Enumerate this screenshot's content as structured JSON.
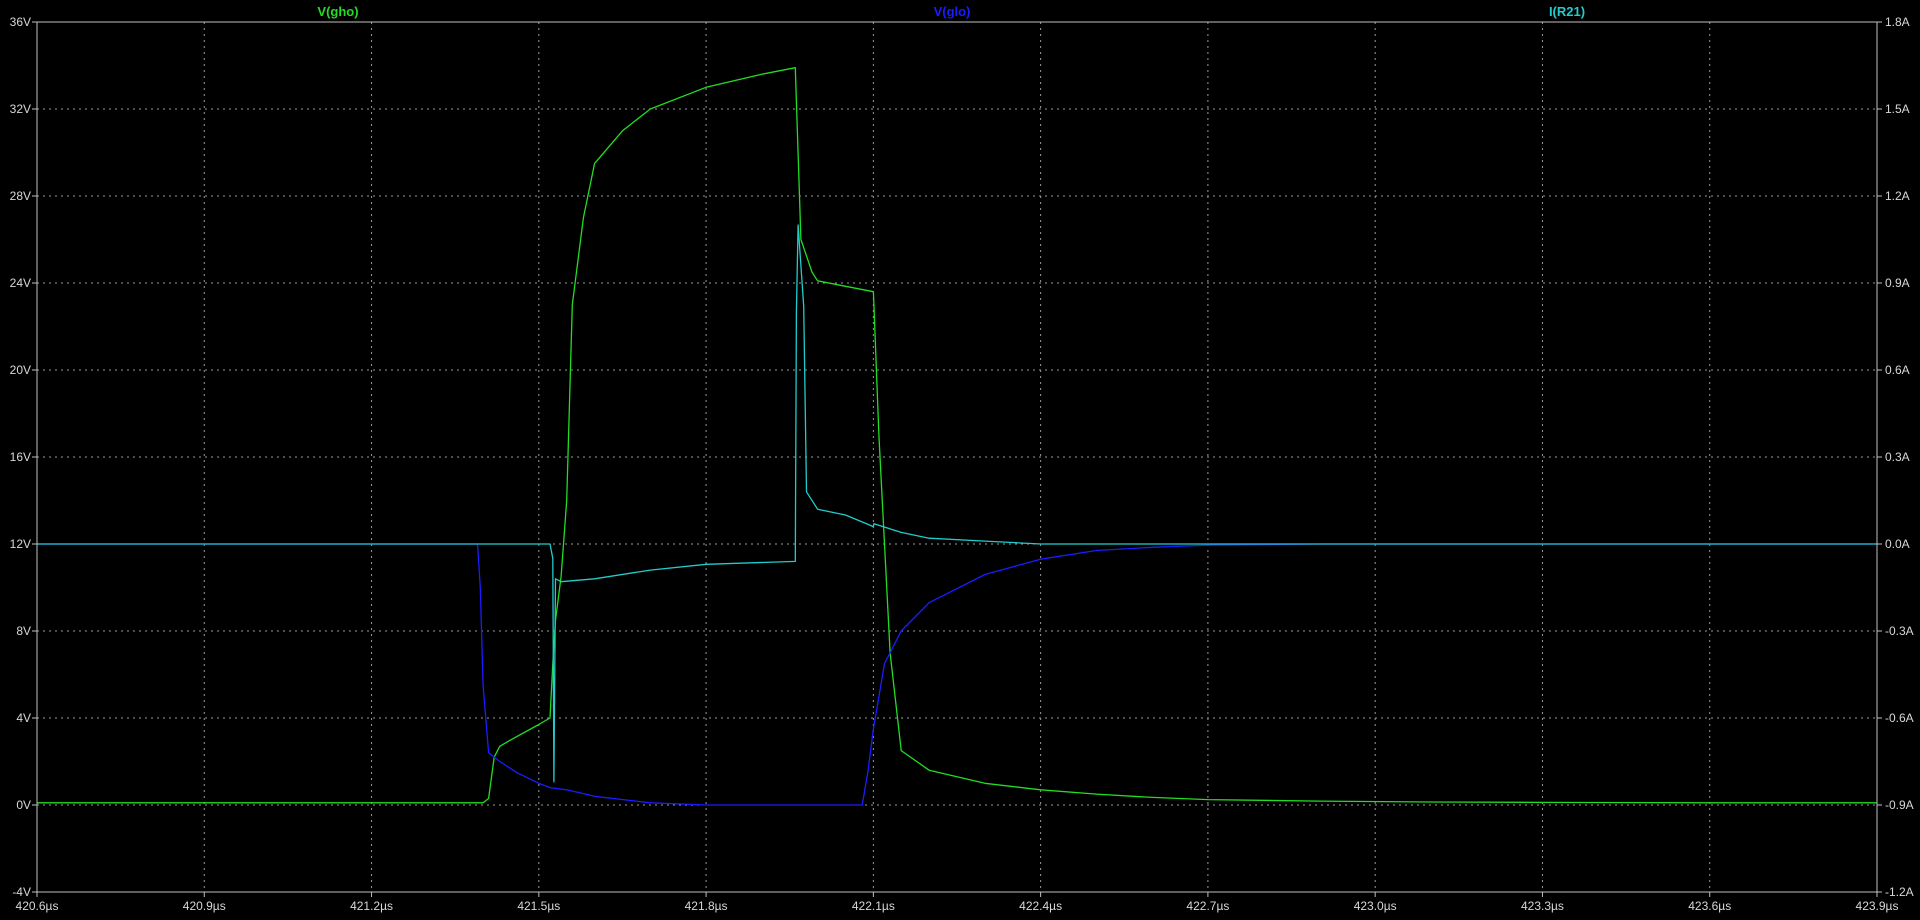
{
  "chart_data": {
    "type": "line",
    "title": "",
    "xlabel": "",
    "ylabel": "",
    "grid": true,
    "legend_placement": "top",
    "background_color": "#000000",
    "grid_color": "#9a9a9a",
    "axis_color": "#c0c0c0",
    "x_axis": {
      "unit": "µs",
      "range": [
        420.6,
        423.9
      ],
      "ticks": [
        "420.6µs",
        "420.9µs",
        "421.2µs",
        "421.5µs",
        "421.8µs",
        "422.1µs",
        "422.4µs",
        "422.7µs",
        "423.0µs",
        "423.3µs",
        "423.6µs",
        "423.9µs"
      ],
      "tick_values": [
        420.6,
        420.9,
        421.2,
        421.5,
        421.8,
        422.1,
        422.4,
        422.7,
        423.0,
        423.3,
        423.6,
        423.9
      ]
    },
    "y_left": {
      "unit": "V",
      "range": [
        -4,
        36
      ],
      "ticks": [
        "-4V",
        "0V",
        "4V",
        "8V",
        "12V",
        "16V",
        "20V",
        "24V",
        "28V",
        "32V",
        "36V"
      ],
      "tick_values": [
        -4,
        0,
        4,
        8,
        12,
        16,
        20,
        24,
        28,
        32,
        36
      ]
    },
    "y_right": {
      "unit": "A",
      "range": [
        -1.2,
        1.8
      ],
      "ticks": [
        "-1.2A",
        "-0.9A",
        "-0.6A",
        "-0.3A",
        "0.0A",
        "0.3A",
        "0.6A",
        "0.9A",
        "1.2A",
        "1.5A",
        "1.8A"
      ],
      "tick_values": [
        -1.2,
        -0.9,
        -0.6,
        -0.3,
        0.0,
        0.3,
        0.6,
        0.9,
        1.2,
        1.5,
        1.8
      ]
    },
    "series": [
      {
        "name": "V(gho)",
        "axis": "left",
        "color": "#22dd22",
        "x": [
          420.6,
          421.4,
          421.41,
          421.42,
          421.43,
          421.45,
          421.5,
          421.52,
          421.525,
          421.53,
          421.54,
          421.55,
          421.56,
          421.58,
          421.6,
          421.65,
          421.7,
          421.8,
          421.9,
          421.96,
          421.97,
          421.99,
          422.0,
          422.04,
          422.1,
          422.11,
          422.13,
          422.15,
          422.2,
          422.3,
          422.4,
          422.5,
          422.6,
          422.7,
          422.9,
          423.1,
          423.3,
          423.6,
          423.9
        ],
        "y": [
          0.1,
          0.1,
          0.3,
          2.2,
          2.7,
          3.0,
          3.7,
          4.0,
          6.5,
          8.5,
          10.5,
          14.0,
          23.0,
          27.0,
          29.5,
          31.0,
          32.0,
          33.0,
          33.6,
          33.9,
          26.0,
          24.5,
          24.1,
          23.9,
          23.6,
          17.0,
          7.0,
          2.5,
          1.6,
          1.0,
          0.7,
          0.5,
          0.35,
          0.25,
          0.18,
          0.14,
          0.12,
          0.1,
          0.1
        ]
      },
      {
        "name": "V(glo)",
        "axis": "left",
        "color": "#1c1cff",
        "x": [
          420.6,
          421.39,
          421.395,
          421.4,
          421.41,
          421.43,
          421.46,
          421.5,
          421.52,
          421.55,
          421.6,
          421.7,
          421.8,
          422.08,
          422.09,
          422.1,
          422.12,
          422.15,
          422.2,
          422.3,
          422.4,
          422.5,
          422.6,
          422.7,
          422.9,
          423.9
        ],
        "y": [
          12.0,
          12.0,
          10.0,
          5.5,
          2.4,
          2.0,
          1.5,
          1.0,
          0.8,
          0.7,
          0.4,
          0.1,
          0.0,
          0.0,
          1.5,
          3.5,
          6.5,
          8.0,
          9.3,
          10.6,
          11.3,
          11.7,
          11.85,
          11.95,
          12.0,
          12.0
        ]
      },
      {
        "name": "I(R21)",
        "axis": "right",
        "color": "#22cccc",
        "x": [
          420.6,
          421.52,
          421.525,
          421.527,
          421.53,
          421.54,
          421.6,
          421.7,
          421.8,
          421.96,
          421.962,
          421.965,
          421.975,
          421.98,
          422.0,
          422.05,
          422.1,
          422.101,
          422.15,
          422.2,
          422.3,
          422.4,
          423.9
        ],
        "y": [
          0.0,
          0.0,
          -0.05,
          -0.82,
          -0.12,
          -0.13,
          -0.12,
          -0.09,
          -0.07,
          -0.06,
          0.8,
          1.1,
          0.82,
          0.18,
          0.12,
          0.1,
          0.06,
          0.07,
          0.04,
          0.02,
          0.01,
          0.0,
          0.0
        ]
      }
    ]
  }
}
